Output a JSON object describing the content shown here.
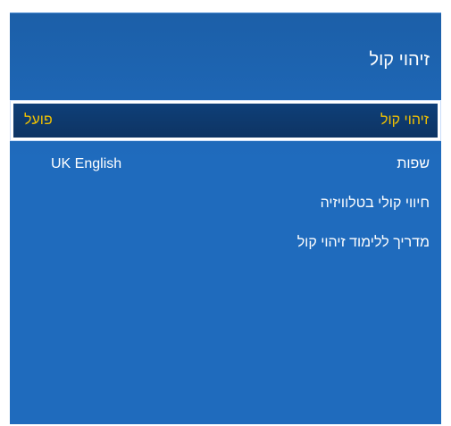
{
  "menu": {
    "title": "זיהוי קול",
    "items": [
      {
        "label": "זיהוי קול",
        "value": "פועל",
        "selected": true
      },
      {
        "label": "שפות",
        "value": "UK English",
        "selected": false
      },
      {
        "label": "חיווי קולי בטלוויזיה",
        "value": "",
        "selected": false
      },
      {
        "label": "מדריך ללימוד זיהוי קול",
        "value": "",
        "selected": false
      }
    ]
  },
  "colors": {
    "panel_background": "#1f6bbd",
    "selected_background": "#0f3f78",
    "selected_text": "#f2c200",
    "text": "#ffffff",
    "selection_border": "#ffffff"
  }
}
